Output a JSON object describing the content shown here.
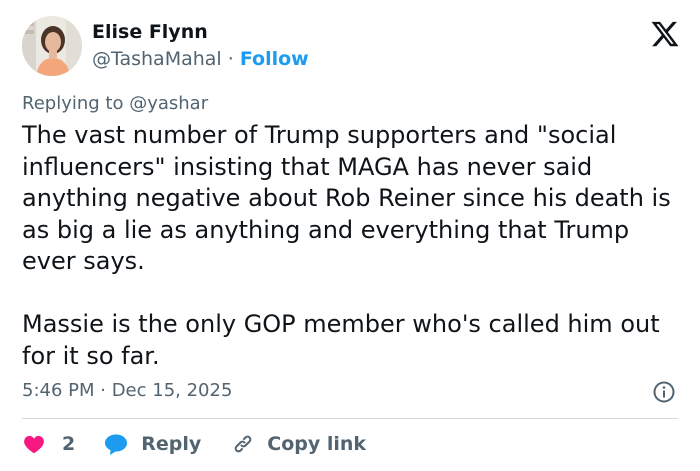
{
  "author": {
    "display_name": "Elise Flynn",
    "handle": "@TashaMahal",
    "separator": " · ",
    "follow_label": "Follow"
  },
  "reply_context": {
    "prefix": "Replying to ",
    "mention": "@yashar"
  },
  "post": {
    "paragraph_1": "The vast number of Trump supporters and \"social influencers\" insisting that MAGA has never said anything negative about Rob Reiner since his death is as big a lie as anything and everything that Trump ever says.",
    "paragraph_2": "Massie is the only GOP member who's called him out for it so far."
  },
  "timestamp": "5:46 PM · Dec 15, 2025",
  "actions": {
    "like_count": "2",
    "reply_label": "Reply",
    "copy_link_label": "Copy link"
  },
  "icons": {
    "logo": "x-logo-icon",
    "info": "info-icon",
    "like": "heart-icon",
    "reply": "speech-bubble-icon",
    "copy": "link-icon"
  },
  "colors": {
    "text": "#0f1419",
    "secondary": "#536471",
    "link": "#1d9bf0",
    "like": "#f91880",
    "divider": "#cfd9de"
  }
}
